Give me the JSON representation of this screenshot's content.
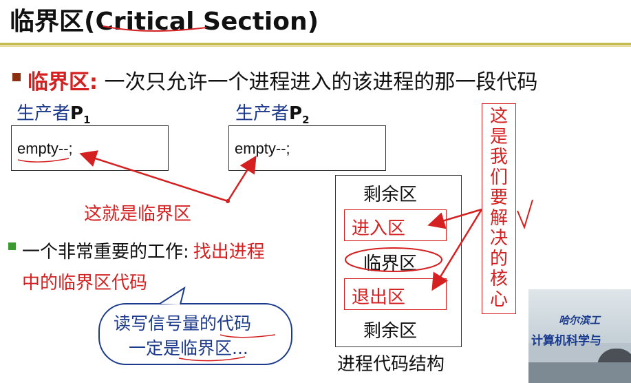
{
  "slide": {
    "title": "临界区(Critical Section)",
    "definition": {
      "term": "临界区:",
      "text": " 一次只允许一个进程进入的该进程的那一段代码"
    },
    "producers": [
      {
        "name": "生产者",
        "sub_label": "P",
        "subscript": "1",
        "code": "empty--;"
      },
      {
        "name": "生产者",
        "sub_label": "P",
        "subscript": "2",
        "code": "empty--;"
      }
    ],
    "arrow_caption": "这就是临界区",
    "task": {
      "label": "一个非常重要的工作:",
      "highlight_line1": "找出进程",
      "highlight_line2": "中的临界区代码"
    },
    "bubble": {
      "line1": "读写信号量的代码",
      "line2": "一定是临界区..."
    },
    "structure": {
      "remainder_top": "剩余区",
      "entry": "进入区",
      "critical": "临界区",
      "exit": "退出区",
      "remainder_bottom": "剩余区",
      "caption": "进程代码结构"
    },
    "side_note": [
      "这",
      "是",
      "我",
      "们",
      "要",
      "解",
      "决",
      "的",
      "核",
      "心"
    ],
    "video_overlay": {
      "line1": "哈尔滨工",
      "line2": "计算机科学与"
    },
    "colors": {
      "accent_red": "#d42020",
      "bullet_brown": "#8c2f10",
      "bullet_green": "#3b9a2f",
      "title_rule": "#c7bb4f",
      "bubble_blue": "#1d3b8c"
    }
  }
}
